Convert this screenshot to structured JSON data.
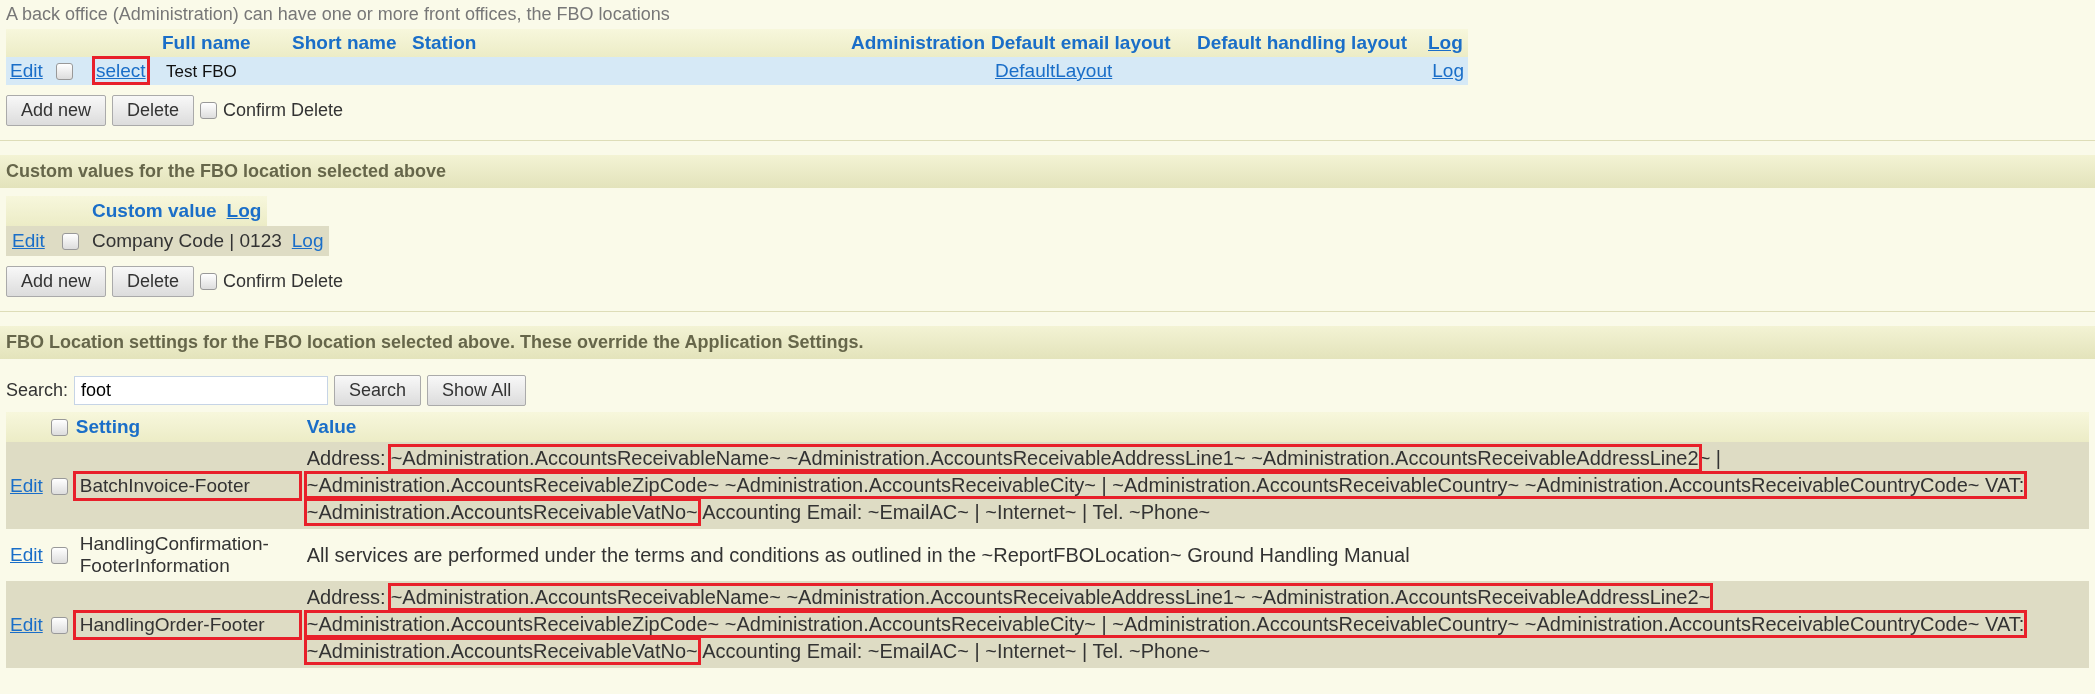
{
  "caption": "A back office (Administration) can have one or more front offices, the FBO locations",
  "fbo_table": {
    "columns": [
      "Full name",
      "Short name",
      "Station",
      "Administration",
      "Default email layout",
      "Default handling layout",
      "Log"
    ],
    "rows": [
      {
        "selected": true,
        "checked": false,
        "edit": "Edit",
        "select": "select",
        "select_highlighted": true,
        "full_name": "Test FBO",
        "email_layout": "DefaultLayout",
        "log": "Log"
      }
    ]
  },
  "fbo_buttons": {
    "add": "Add new",
    "delete": "Delete",
    "confirm_label": "Confirm Delete",
    "confirm_checked": false
  },
  "custom_section": {
    "title": "Custom values for the FBO location selected above",
    "columns": [
      "Custom value",
      "Log"
    ],
    "rows": [
      {
        "checked": false,
        "edit": "Edit",
        "value": "Company Code | 0123",
        "log": "Log"
      }
    ],
    "buttons": {
      "add": "Add new",
      "delete": "Delete",
      "confirm_label": "Confirm Delete",
      "confirm_checked": false
    }
  },
  "settings_section": {
    "title": "FBO Location settings for the FBO location selected above. These override the Application Settings.",
    "search": {
      "label": "Search:",
      "value": "foot",
      "buttons": [
        "Search",
        "Show All"
      ]
    },
    "header_checked": false,
    "columns": [
      "Setting",
      "Value"
    ],
    "rows": [
      {
        "checked": false,
        "edit": "Edit",
        "setting": "BatchInvoice-Footer",
        "highlighted": true,
        "value_lines": [
          [
            {
              "text": "Address:",
              "highlighted": false
            },
            {
              "text": "~Administration.AccountsReceivableName~ ~Administration.AccountsReceivableAddressLine1~ ~Administration.AccountsReceivableAddressLine2",
              "highlighted": true
            },
            {
              "text": "~ |",
              "highlighted": false
            }
          ],
          [
            {
              "text": "~Administration.AccountsReceivableZipCode~ ~Administration.AccountsReceivableCity~ | ~Administration.AccountsReceivableCountry~ ~Administration.AccountsReceivableCountryCode~ VAT:",
              "highlighted": true
            }
          ],
          [
            {
              "text": "~Administration.AccountsReceivableVatNo~",
              "highlighted": true
            },
            {
              "text": " Accounting Email: ~EmailAC~ | ~Internet~ | Tel. ~Phone~",
              "highlighted": false
            }
          ]
        ]
      },
      {
        "checked": false,
        "edit": "Edit",
        "setting": "HandlingConfirmation-FooterInformation",
        "highlighted": false,
        "value_lines": [
          [
            {
              "text": "All services are performed under the terms and conditions as outlined in the ~ReportFBOLocation~ Ground Handling Manual",
              "highlighted": false
            }
          ]
        ]
      },
      {
        "checked": false,
        "edit": "Edit",
        "setting": "HandlingOrder-Footer",
        "highlighted": true,
        "value_lines": [
          [
            {
              "text": "Address:",
              "highlighted": false
            },
            {
              "text": "~Administration.AccountsReceivableName~ ~Administration.AccountsReceivableAddressLine1~ ~Administration.AccountsReceivableAddressLine2~",
              "highlighted": true
            }
          ],
          [
            {
              "text": "~Administration.AccountsReceivableZipCode~ ~Administration.AccountsReceivableCity~ | ~Administration.AccountsReceivableCountry~ ~Administration.AccountsReceivableCountryCode~ VAT:",
              "highlighted": true
            }
          ],
          [
            {
              "text": "~Administration.AccountsReceivableVatNo~",
              "highlighted": true
            },
            {
              "text": " Accounting Email: ~EmailAC~ | ~Internet~ | Tel. ~Phone~",
              "highlighted": false
            }
          ]
        ]
      }
    ]
  }
}
